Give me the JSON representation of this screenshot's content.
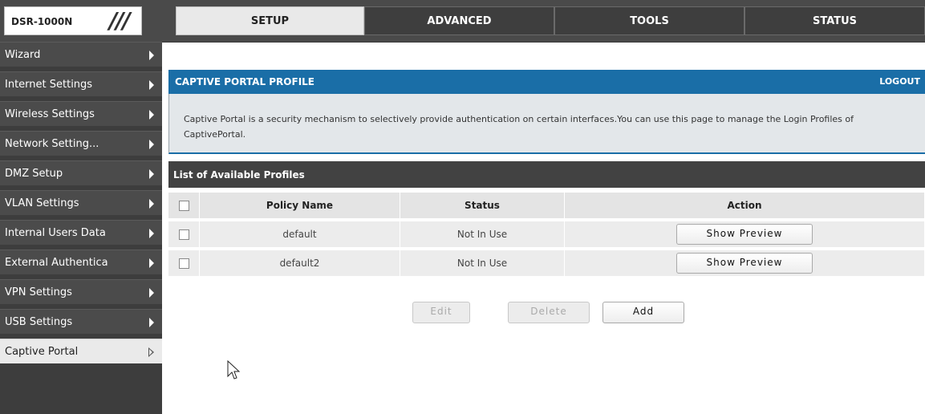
{
  "header": {
    "logo_text": "DSR-1000N",
    "tabs": [
      {
        "label": "SETUP",
        "active": true
      },
      {
        "label": "ADVANCED",
        "active": false
      },
      {
        "label": "TOOLS",
        "active": false
      },
      {
        "label": "STATUS",
        "active": false
      }
    ]
  },
  "sidebar": {
    "items": [
      {
        "label": "Wizard",
        "icon": "chevron-right-icon",
        "active": false
      },
      {
        "label": "Internet Settings",
        "icon": "chevron-right-icon",
        "active": false
      },
      {
        "label": "Wireless Settings",
        "icon": "chevron-right-icon",
        "active": false
      },
      {
        "label": "Network Setting...",
        "icon": "chevron-right-icon",
        "active": false
      },
      {
        "label": "DMZ Setup",
        "icon": "chevron-right-icon",
        "active": false
      },
      {
        "label": "VLAN Settings",
        "icon": "chevron-right-icon",
        "active": false
      },
      {
        "label": "Internal Users Data",
        "icon": "chevron-right-icon",
        "active": false
      },
      {
        "label": "External Authentica",
        "icon": "chevron-right-icon",
        "active": false
      },
      {
        "label": "VPN Settings",
        "icon": "chevron-right-icon",
        "active": false
      },
      {
        "label": "USB Settings",
        "icon": "chevron-right-icon",
        "active": false
      },
      {
        "label": "Captive Portal",
        "icon": "chevron-right-outline-icon",
        "active": true
      }
    ]
  },
  "main": {
    "title": "CAPTIVE PORTAL PROFILE",
    "logout_label": "LOGOUT",
    "description": "Captive Portal is a security mechanism to selectively provide authentication on certain interfaces.You can use this page to manage the Login Profiles of CaptivePortal.",
    "list_title": "List of Available Profiles",
    "columns": [
      "Policy Name",
      "Status",
      "Action"
    ],
    "rows": [
      {
        "policy_name": "default",
        "status": "Not In Use",
        "action_label": "Show Preview"
      },
      {
        "policy_name": "default2",
        "status": "Not In Use",
        "action_label": "Show Preview"
      }
    ],
    "buttons": {
      "edit_label": "Edit",
      "delete_label": "Delete",
      "add_label": "Add"
    }
  },
  "colors": {
    "accent_blue": "#1a6ea7",
    "sidebar_bg": "#4b4b4b",
    "topbar_bg": "#4a4a4a"
  }
}
